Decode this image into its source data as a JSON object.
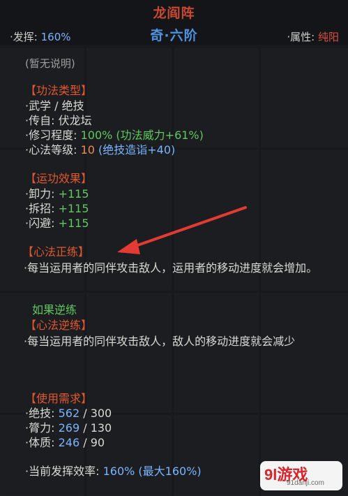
{
  "header": {
    "title": "龙阎阵",
    "grade": "奇·六阶",
    "play_label": "·发挥:",
    "play_value": "160%",
    "attr_label": "·属性:",
    "attr_value": "纯阳"
  },
  "no_desc": "(暂无说明)",
  "skill_type": {
    "heading": "【功法类型】",
    "line1": "·武学 / 绝技",
    "line2": "·传自: 伏龙坛",
    "mastery_label": "·修习程度: ",
    "mastery_value": "100%",
    "mastery_bonus": "(功法威力+61%)",
    "level_label": "·心法等级: ",
    "level_value": "10",
    "level_bonus": "(绝技造诣+40)"
  },
  "effects": {
    "heading": "【运功效果】",
    "items": [
      {
        "label": "·卸力: ",
        "value": "+115"
      },
      {
        "label": "·拆招: ",
        "value": "+115"
      },
      {
        "label": "·闪避: ",
        "value": "+115"
      }
    ]
  },
  "positive": {
    "heading": "【心法正练】",
    "desc": "·每当运用者的同伴攻击敌人，运用者的移动进度就会增加。"
  },
  "reverse": {
    "intro": "如果逆练",
    "heading": "【心法逆练】",
    "desc": "·每当运用者的同伴攻击敌人，敌人的移动进度就会减少"
  },
  "requirements": {
    "heading": "【使用需求】",
    "items": [
      {
        "label": "·绝技: ",
        "current": "562",
        "required": "/ 300"
      },
      {
        "label": "·膂力: ",
        "current": "269",
        "required": "/ 130"
      },
      {
        "label": "·体质: ",
        "current": "246",
        "required": "/ 90"
      }
    ]
  },
  "efficiency": {
    "label": "·当前发挥效率: ",
    "value": "160%",
    "max": "(最大160%)"
  },
  "logo": {
    "big": "9l游戏",
    "small": "91danji.com"
  },
  "colors": {
    "title": "#c9492f",
    "grade": "#4c93df",
    "section": "#e1582f",
    "green": "#5fc95f",
    "blue": "#79b5ff",
    "arrow": "#e23b33"
  }
}
